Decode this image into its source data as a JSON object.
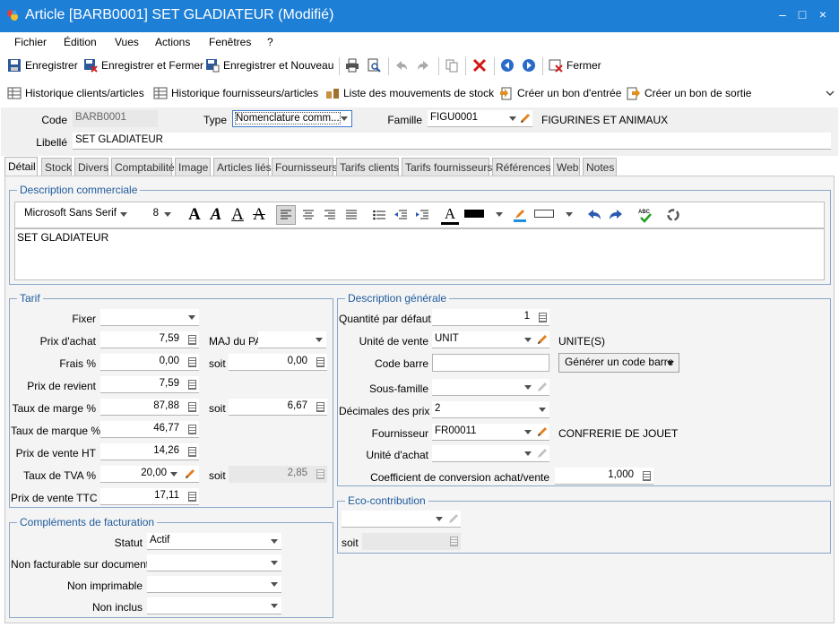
{
  "window": {
    "title": "Article [BARB0001] SET GLADIATEUR (Modifié)",
    "minimize": "–",
    "maximize": "□",
    "close": "×"
  },
  "menu": [
    "Fichier",
    "Édition",
    "Vues",
    "Actions",
    "Fenêtres",
    "?"
  ],
  "toolbar1": {
    "save": "Enregistrer",
    "save_close": "Enregistrer et Fermer",
    "save_new": "Enregistrer et Nouveau",
    "close": "Fermer"
  },
  "toolbar2": {
    "hist_clients": "Historique clients/articles",
    "hist_fourn": "Historique fournisseurs/articles",
    "movements": "Liste des mouvements de stock",
    "entry": "Créer un bon d'entrée",
    "exit": "Créer un bon de sortie"
  },
  "header": {
    "code_label": "Code",
    "code": "BARB0001",
    "type_label": "Type",
    "type": "Nomenclature comm...",
    "famille_label": "Famille",
    "famille": "FIGU0001",
    "famille_desc": "FIGURINES ET ANIMAUX",
    "libelle_label": "Libellé",
    "libelle": "SET GLADIATEUR"
  },
  "tabs": [
    "Détail",
    "Stock",
    "Divers",
    "Comptabilité",
    "Image",
    "Articles liés",
    "Fournisseurs",
    "Tarifs clients",
    "Tarifs fournisseurs",
    "Références",
    "Web",
    "Notes"
  ],
  "desc_com": {
    "title": "Description commerciale",
    "font": "Microsoft Sans Serif",
    "size": "8",
    "text": "SET GLADIATEUR",
    "text_color": "#000000"
  },
  "tarif": {
    "title": "Tarif",
    "fixer_label": "Fixer",
    "fixer": "",
    "achat_label": "Prix d'achat",
    "achat": "7,59",
    "maj_label": "MAJ du PA",
    "maj": "",
    "frais_label": "Frais %",
    "frais": "0,00",
    "soit1_label": "soit",
    "soit1": "0,00",
    "revient_label": "Prix de revient",
    "revient": "7,59",
    "taux_marge_label": "Taux de marge %",
    "taux_marge": "87,88",
    "soit2_label": "soit",
    "soit2": "6,67",
    "taux_marque_label": "Taux de marque %",
    "taux_marque": "46,77",
    "vente_ht_label": "Prix de vente HT",
    "vente_ht": "14,26",
    "tva_label": "Taux de TVA %",
    "tva": "20,00",
    "soit3_label": "soit",
    "soit3": "2,85",
    "vente_ttc_label": "Prix de vente TTC",
    "vente_ttc": "17,11"
  },
  "complements": {
    "title": "Compléments de facturation",
    "statut_label": "Statut",
    "statut": "Actif",
    "nonfact_label": "Non facturable sur documents",
    "nonfact": "",
    "nonimpr_label": "Non imprimable",
    "nonimpr": "",
    "noninclus_label": "Non inclus",
    "noninclus": ""
  },
  "desc_gen": {
    "title": "Description générale",
    "qte_label": "Quantité par défaut",
    "qte": "1",
    "unite_label": "Unité de vente",
    "unite": "UNIT",
    "unite_desc": "UNITE(S)",
    "barre_label": "Code barre",
    "barre": "",
    "barre_btn": "Générer un code barre",
    "sousfam_label": "Sous-famille",
    "sousfam": "",
    "dec_label": "Décimales des prix",
    "dec": "2",
    "fourn_label": "Fournisseur",
    "fourn": "FR00011",
    "fourn_desc": "CONFRERIE DE JOUET",
    "unite_achat_label": "Unité d'achat",
    "unite_achat": "",
    "coef_label": "Coefficient de conversion achat/vente",
    "coef": "1,000"
  },
  "eco": {
    "title": "Eco-contribution",
    "value": "",
    "soit_label": "soit",
    "soit": ""
  },
  "colors": {
    "titlebar": "#1e7fd6",
    "group_title": "#1e5a9c"
  }
}
